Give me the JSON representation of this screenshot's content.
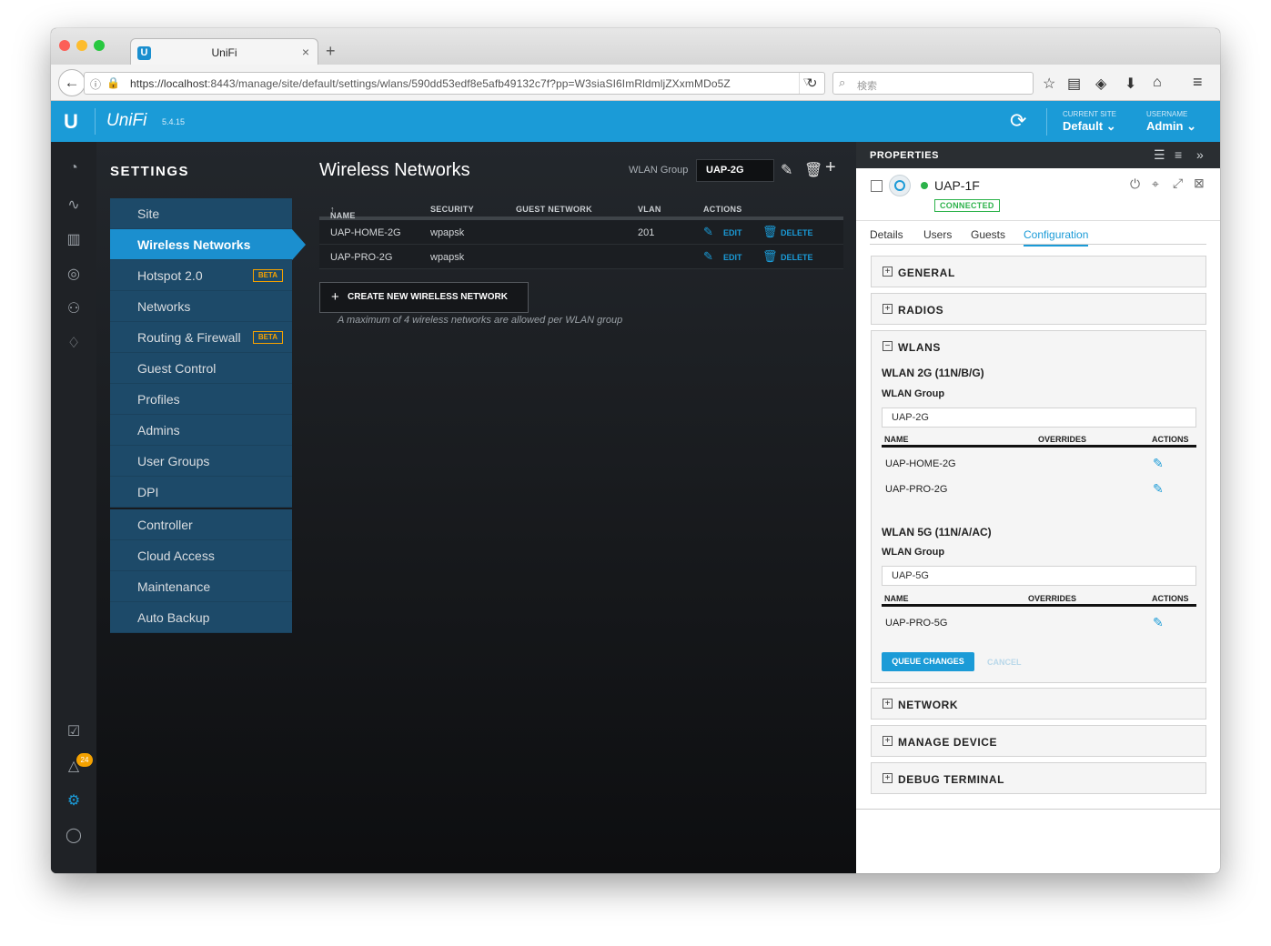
{
  "browser": {
    "tab_title": "UniFi",
    "url_host": "https://localhost",
    "url_rest": ":8443/manage/site/default/settings/wlans/590dd53edf8e5afb49132c7f?pp=W3siaSI6ImRldmljZXxmMDo5Z",
    "search_placeholder": "検索"
  },
  "header": {
    "brand": "UniFi",
    "version": "5.4.15",
    "current_site_label": "CURRENT SITE",
    "current_site_value": "Default",
    "username_label": "USERNAME",
    "username_value": "Admin"
  },
  "left_nav": {
    "alerts_badge": "24"
  },
  "settings": {
    "title": "SETTINGS",
    "menu": [
      {
        "label": "Site"
      },
      {
        "label": "Wireless Networks",
        "active": true
      },
      {
        "label": "Hotspot 2.0",
        "badge": "BETA"
      },
      {
        "label": "Networks"
      },
      {
        "label": "Routing & Firewall",
        "badge": "BETA"
      },
      {
        "label": "Guest Control"
      },
      {
        "label": "Profiles"
      },
      {
        "label": "Admins"
      },
      {
        "label": "User Groups"
      },
      {
        "label": "DPI"
      }
    ],
    "menu2": [
      {
        "label": "Controller"
      },
      {
        "label": "Cloud Access"
      },
      {
        "label": "Maintenance"
      },
      {
        "label": "Auto Backup"
      }
    ]
  },
  "wireless": {
    "title": "Wireless Networks",
    "wlan_group_label": "WLAN Group",
    "wlan_group_value": "UAP-2G",
    "columns": [
      "NAME",
      "SECURITY",
      "GUEST NETWORK",
      "VLAN",
      "ACTIONS"
    ],
    "sort_indicator": "↑",
    "rows": [
      {
        "name": "UAP-HOME-2G",
        "security": "wpapsk",
        "guest": "",
        "vlan": "201",
        "edit": "EDIT",
        "delete": "DELETE"
      },
      {
        "name": "UAP-PRO-2G",
        "security": "wpapsk",
        "guest": "",
        "vlan": "",
        "edit": "EDIT",
        "delete": "DELETE"
      }
    ],
    "create_label": "CREATE NEW WIRELESS NETWORK",
    "note": "A maximum of 4 wireless networks are allowed per WLAN group"
  },
  "properties": {
    "title": "PROPERTIES",
    "device_name": "UAP-1F",
    "status": "CONNECTED",
    "status_color": "#2cb24a",
    "tabs": [
      "Details",
      "Users",
      "Guests",
      "Configuration"
    ],
    "active_tab": "Configuration",
    "sections": {
      "general": "GENERAL",
      "radios": "RADIOS",
      "wlans": "WLANS",
      "network": "NETWORK",
      "manage": "MANAGE DEVICE",
      "debug": "DEBUG TERMINAL"
    },
    "wlan2g": {
      "title": "WLAN 2G (11N/B/G)",
      "group_label": "WLAN Group",
      "group_value": "UAP-2G",
      "col_name": "NAME",
      "col_overrides": "OVERRIDES",
      "col_actions": "ACTIONS",
      "rows": [
        "UAP-HOME-2G",
        "UAP-PRO-2G"
      ]
    },
    "wlan5g": {
      "title": "WLAN 5G (11N/A/AC)",
      "group_label": "WLAN Group",
      "group_value": "UAP-5G",
      "col_name": "NAME",
      "col_overrides": "OVERRIDES",
      "col_actions": "ACTIONS",
      "rows": [
        "UAP-PRO-5G"
      ]
    },
    "queue_label": "QUEUE CHANGES",
    "cancel_label": "CANCEL"
  },
  "colors": {
    "accent": "#1b9bd7",
    "sidebar_item": "#1d4a69",
    "beta": "#f5a200"
  }
}
